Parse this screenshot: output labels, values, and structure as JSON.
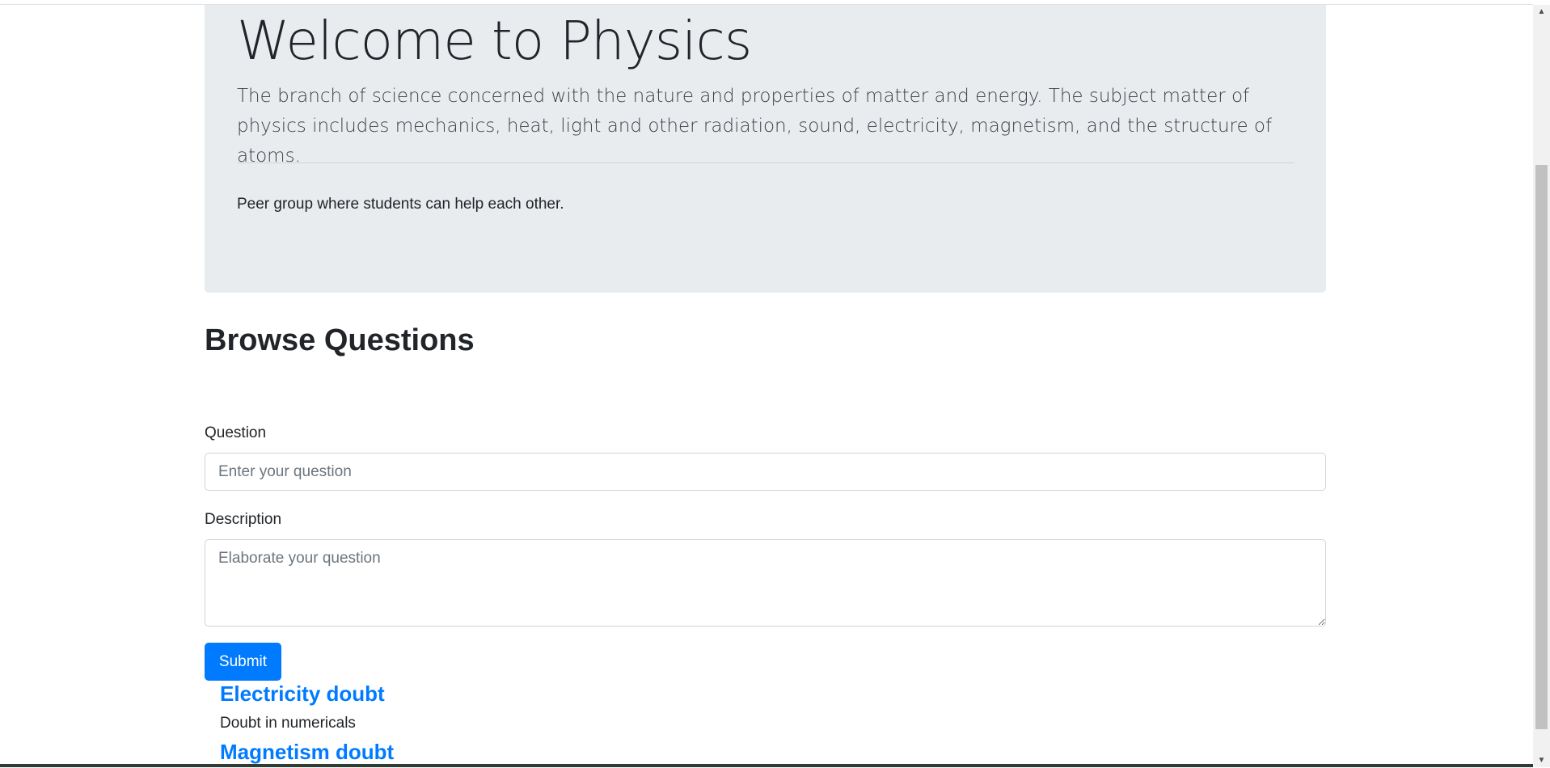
{
  "jumbotron": {
    "title": "Welcome to Physics",
    "lead": "The branch of science concerned with the nature and properties of matter and energy. The subject matter of physics includes mechanics, heat, light and other radiation, sound, electricity, magnetism, and the structure of atoms.",
    "text": "Peer group where students can help each other."
  },
  "browse": {
    "title": "Browse Questions"
  },
  "form": {
    "question_label": "Question",
    "question_placeholder": "Enter your question",
    "description_label": "Description",
    "description_placeholder": "Elaborate your question",
    "submit_label": "Submit"
  },
  "questions": [
    {
      "title": "Electricity doubt",
      "description": "Doubt in numericals"
    },
    {
      "title": "Magnetism doubt",
      "description": ""
    }
  ],
  "icons": {
    "scroll_up": "arrow-up-icon",
    "scroll_down": "arrow-down-icon"
  },
  "colors": {
    "accent": "#007bff",
    "jumbotron_bg": "#e9ecef"
  }
}
